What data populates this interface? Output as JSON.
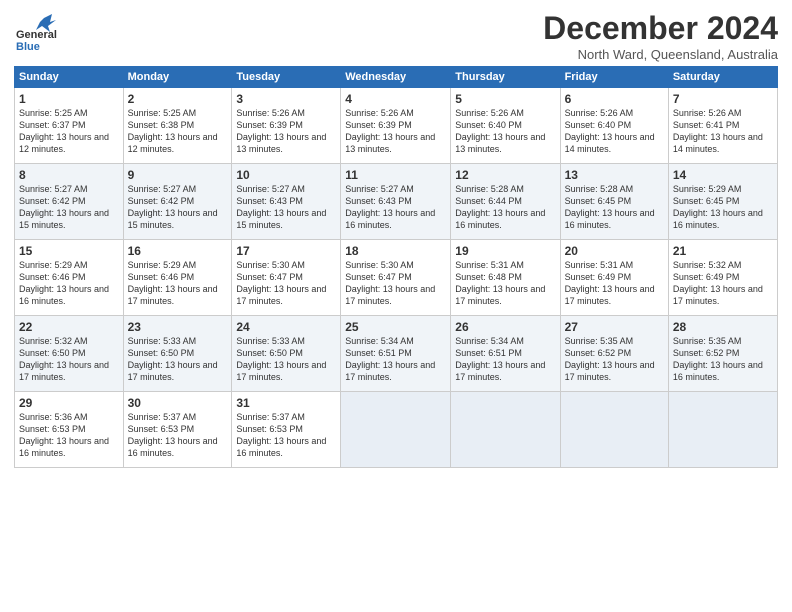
{
  "header": {
    "logo_general": "General",
    "logo_blue": "Blue",
    "month_title": "December 2024",
    "subtitle": "North Ward, Queensland, Australia"
  },
  "columns": [
    "Sunday",
    "Monday",
    "Tuesday",
    "Wednesday",
    "Thursday",
    "Friday",
    "Saturday"
  ],
  "weeks": [
    [
      {
        "day": "1",
        "sunrise": "Sunrise: 5:25 AM",
        "sunset": "Sunset: 6:37 PM",
        "daylight": "Daylight: 13 hours and 12 minutes."
      },
      {
        "day": "2",
        "sunrise": "Sunrise: 5:25 AM",
        "sunset": "Sunset: 6:38 PM",
        "daylight": "Daylight: 13 hours and 12 minutes."
      },
      {
        "day": "3",
        "sunrise": "Sunrise: 5:26 AM",
        "sunset": "Sunset: 6:39 PM",
        "daylight": "Daylight: 13 hours and 13 minutes."
      },
      {
        "day": "4",
        "sunrise": "Sunrise: 5:26 AM",
        "sunset": "Sunset: 6:39 PM",
        "daylight": "Daylight: 13 hours and 13 minutes."
      },
      {
        "day": "5",
        "sunrise": "Sunrise: 5:26 AM",
        "sunset": "Sunset: 6:40 PM",
        "daylight": "Daylight: 13 hours and 13 minutes."
      },
      {
        "day": "6",
        "sunrise": "Sunrise: 5:26 AM",
        "sunset": "Sunset: 6:40 PM",
        "daylight": "Daylight: 13 hours and 14 minutes."
      },
      {
        "day": "7",
        "sunrise": "Sunrise: 5:26 AM",
        "sunset": "Sunset: 6:41 PM",
        "daylight": "Daylight: 13 hours and 14 minutes."
      }
    ],
    [
      {
        "day": "8",
        "sunrise": "Sunrise: 5:27 AM",
        "sunset": "Sunset: 6:42 PM",
        "daylight": "Daylight: 13 hours and 15 minutes."
      },
      {
        "day": "9",
        "sunrise": "Sunrise: 5:27 AM",
        "sunset": "Sunset: 6:42 PM",
        "daylight": "Daylight: 13 hours and 15 minutes."
      },
      {
        "day": "10",
        "sunrise": "Sunrise: 5:27 AM",
        "sunset": "Sunset: 6:43 PM",
        "daylight": "Daylight: 13 hours and 15 minutes."
      },
      {
        "day": "11",
        "sunrise": "Sunrise: 5:27 AM",
        "sunset": "Sunset: 6:43 PM",
        "daylight": "Daylight: 13 hours and 16 minutes."
      },
      {
        "day": "12",
        "sunrise": "Sunrise: 5:28 AM",
        "sunset": "Sunset: 6:44 PM",
        "daylight": "Daylight: 13 hours and 16 minutes."
      },
      {
        "day": "13",
        "sunrise": "Sunrise: 5:28 AM",
        "sunset": "Sunset: 6:45 PM",
        "daylight": "Daylight: 13 hours and 16 minutes."
      },
      {
        "day": "14",
        "sunrise": "Sunrise: 5:29 AM",
        "sunset": "Sunset: 6:45 PM",
        "daylight": "Daylight: 13 hours and 16 minutes."
      }
    ],
    [
      {
        "day": "15",
        "sunrise": "Sunrise: 5:29 AM",
        "sunset": "Sunset: 6:46 PM",
        "daylight": "Daylight: 13 hours and 16 minutes."
      },
      {
        "day": "16",
        "sunrise": "Sunrise: 5:29 AM",
        "sunset": "Sunset: 6:46 PM",
        "daylight": "Daylight: 13 hours and 17 minutes."
      },
      {
        "day": "17",
        "sunrise": "Sunrise: 5:30 AM",
        "sunset": "Sunset: 6:47 PM",
        "daylight": "Daylight: 13 hours and 17 minutes."
      },
      {
        "day": "18",
        "sunrise": "Sunrise: 5:30 AM",
        "sunset": "Sunset: 6:47 PM",
        "daylight": "Daylight: 13 hours and 17 minutes."
      },
      {
        "day": "19",
        "sunrise": "Sunrise: 5:31 AM",
        "sunset": "Sunset: 6:48 PM",
        "daylight": "Daylight: 13 hours and 17 minutes."
      },
      {
        "day": "20",
        "sunrise": "Sunrise: 5:31 AM",
        "sunset": "Sunset: 6:49 PM",
        "daylight": "Daylight: 13 hours and 17 minutes."
      },
      {
        "day": "21",
        "sunrise": "Sunrise: 5:32 AM",
        "sunset": "Sunset: 6:49 PM",
        "daylight": "Daylight: 13 hours and 17 minutes."
      }
    ],
    [
      {
        "day": "22",
        "sunrise": "Sunrise: 5:32 AM",
        "sunset": "Sunset: 6:50 PM",
        "daylight": "Daylight: 13 hours and 17 minutes."
      },
      {
        "day": "23",
        "sunrise": "Sunrise: 5:33 AM",
        "sunset": "Sunset: 6:50 PM",
        "daylight": "Daylight: 13 hours and 17 minutes."
      },
      {
        "day": "24",
        "sunrise": "Sunrise: 5:33 AM",
        "sunset": "Sunset: 6:50 PM",
        "daylight": "Daylight: 13 hours and 17 minutes."
      },
      {
        "day": "25",
        "sunrise": "Sunrise: 5:34 AM",
        "sunset": "Sunset: 6:51 PM",
        "daylight": "Daylight: 13 hours and 17 minutes."
      },
      {
        "day": "26",
        "sunrise": "Sunrise: 5:34 AM",
        "sunset": "Sunset: 6:51 PM",
        "daylight": "Daylight: 13 hours and 17 minutes."
      },
      {
        "day": "27",
        "sunrise": "Sunrise: 5:35 AM",
        "sunset": "Sunset: 6:52 PM",
        "daylight": "Daylight: 13 hours and 17 minutes."
      },
      {
        "day": "28",
        "sunrise": "Sunrise: 5:35 AM",
        "sunset": "Sunset: 6:52 PM",
        "daylight": "Daylight: 13 hours and 16 minutes."
      }
    ],
    [
      {
        "day": "29",
        "sunrise": "Sunrise: 5:36 AM",
        "sunset": "Sunset: 6:53 PM",
        "daylight": "Daylight: 13 hours and 16 minutes."
      },
      {
        "day": "30",
        "sunrise": "Sunrise: 5:37 AM",
        "sunset": "Sunset: 6:53 PM",
        "daylight": "Daylight: 13 hours and 16 minutes."
      },
      {
        "day": "31",
        "sunrise": "Sunrise: 5:37 AM",
        "sunset": "Sunset: 6:53 PM",
        "daylight": "Daylight: 13 hours and 16 minutes."
      },
      null,
      null,
      null,
      null
    ]
  ]
}
